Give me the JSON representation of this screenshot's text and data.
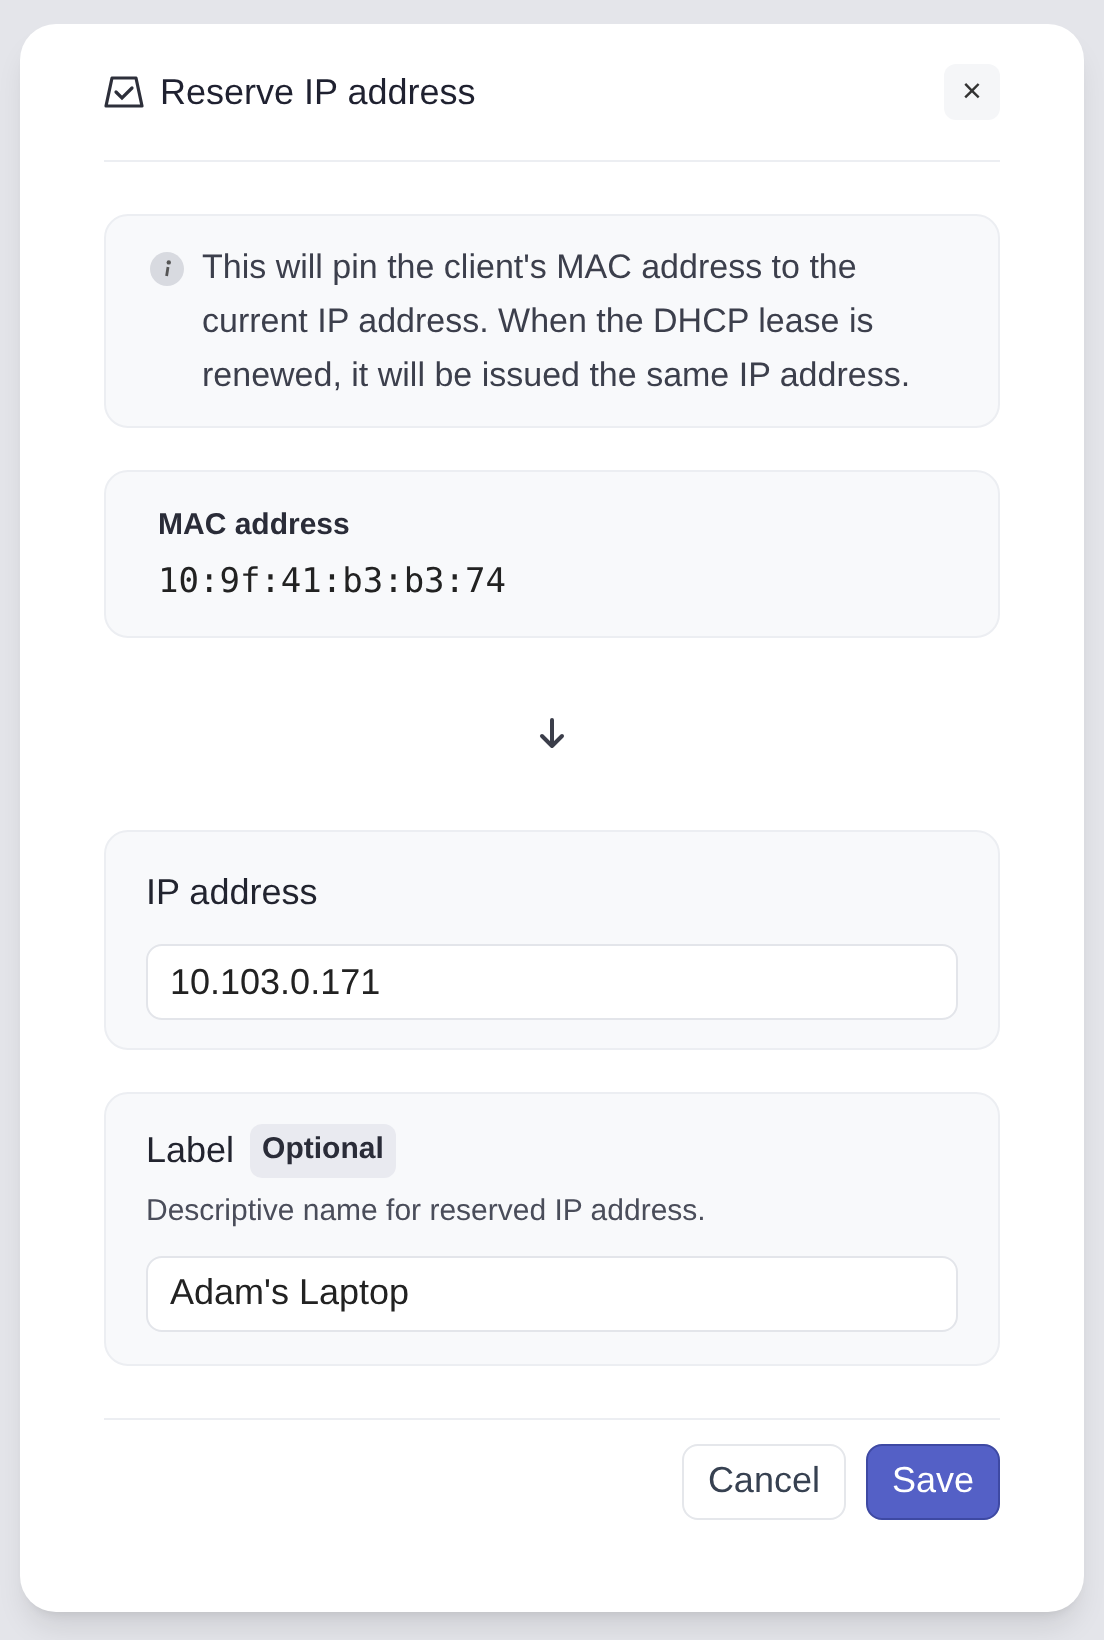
{
  "dialog": {
    "title": "Reserve IP address",
    "close": "×"
  },
  "info": "This will pin the client's MAC address to the current IP address. When the DHCP lease is renewed, it will be issued the same IP address.",
  "mac": {
    "label": "MAC address",
    "value": "10:9f:41:b3:b3:74"
  },
  "ip": {
    "label": "IP address",
    "value": "10.103.0.171"
  },
  "name_field": {
    "label": "Label",
    "badge": "Optional",
    "hint": "Descriptive name for reserved IP address.",
    "value": "Adam's Laptop"
  },
  "buttons": [
    {
      "label": "Cancel",
      "kind": "secondary"
    },
    {
      "label": "Save",
      "kind": "primary"
    }
  ]
}
